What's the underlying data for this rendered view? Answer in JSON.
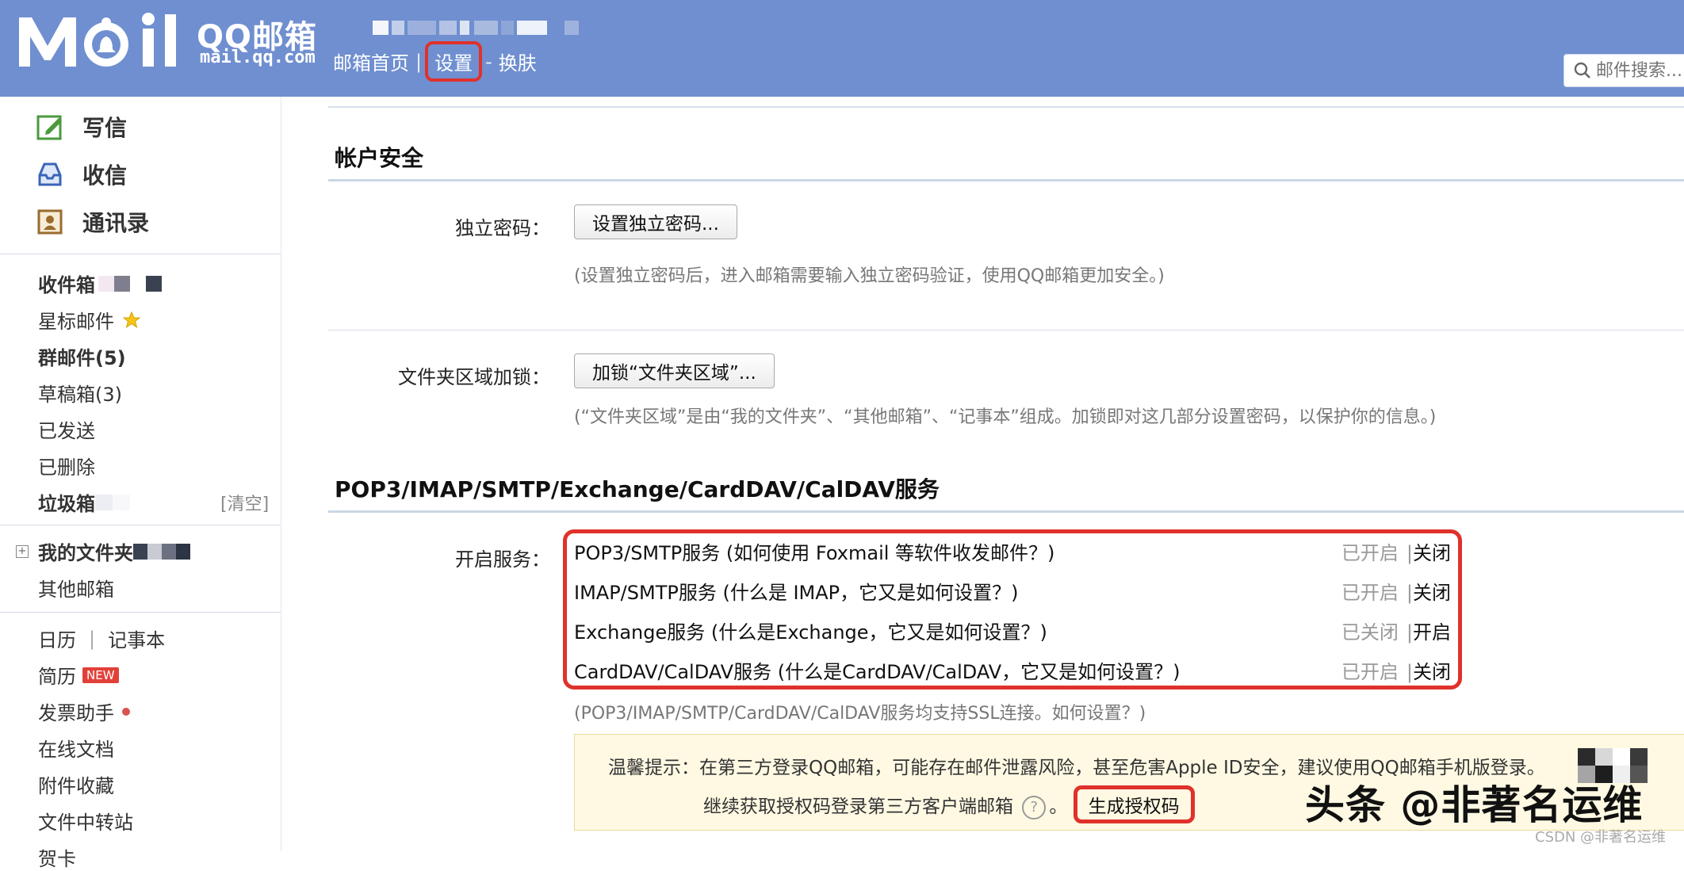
{
  "header": {
    "brand_title": "QQ邮箱",
    "brand_url": "mail.qq.com",
    "nav": {
      "home": "邮箱首页",
      "separator1": "|",
      "settings": "设置",
      "separator2": "-",
      "skin": "换肤"
    },
    "search_placeholder": "邮件搜索..."
  },
  "sidebar": {
    "actions": {
      "compose": "写信",
      "inbox": "收信",
      "contacts": "通讯录"
    },
    "folders": {
      "inbox": "收件箱",
      "starred": "星标邮件",
      "group": "群邮件(5)",
      "drafts": "草稿箱(3)",
      "sent": "已发送",
      "deleted": "已删除",
      "spam": "垃圾箱",
      "clear": "[清空]",
      "my_folders": "我的文件夹",
      "other_mailbox": "其他邮箱"
    },
    "apps": {
      "calendar": "日历",
      "pipe": "|",
      "notebook": "记事本",
      "resume": "简历",
      "new_badge": "NEW",
      "invoice": "发票助手",
      "docs": "在线文档",
      "attachments": "附件收藏",
      "transfer": "文件中转站",
      "cards": "贺卡"
    }
  },
  "content": {
    "account_security": {
      "title": "帐户安全",
      "independent_password_label": "独立密码：",
      "independent_password_button": "设置独立密码...",
      "independent_password_hint": "(设置独立密码后，进入邮箱需要输入独立密码验证，使用QQ邮箱更加安全。)",
      "folder_lock_label": "文件夹区域加锁：",
      "folder_lock_button": "加锁“文件夹区域”...",
      "folder_lock_hint": "(“文件夹区域”是由“我的文件夹”、“其他邮箱”、“记事本”组成。加锁即对这几部分设置密码，以保护你的信息。)"
    },
    "services": {
      "title": "POP3/IMAP/SMTP/Exchange/CardDAV/CalDAV服务",
      "label": "开启服务：",
      "rows": [
        {
          "name": "POP3/SMTP服务 (如何使用 Foxmail 等软件收发邮件？)",
          "status": "已开启",
          "bar": "|",
          "action": "关闭"
        },
        {
          "name": "IMAP/SMTP服务 (什么是 IMAP，它又是如何设置？)",
          "status": "已开启",
          "bar": "|",
          "action": "关闭"
        },
        {
          "name": "Exchange服务 (什么是Exchange，它又是如何设置？)",
          "status": "已关闭",
          "bar": "|",
          "action": "开启"
        },
        {
          "name": "CardDAV/CalDAV服务 (什么是CardDAV/CalDAV，它又是如何设置？)",
          "status": "已开启",
          "bar": "|",
          "action": "关闭"
        }
      ],
      "ssl_hint": "(POP3/IMAP/SMTP/CardDAV/CalDAV服务均支持SSL连接。如何设置？)"
    },
    "tip": {
      "line1": "温馨提示：在第三方登录QQ邮箱，可能存在邮件泄露风险，甚至危害Apple ID安全，建议使用QQ邮箱手机版登录。",
      "line2_prefix": "继续获取授权码登录第三方客户端邮箱",
      "help": "?",
      "period": "。",
      "generate_button": "生成授权码"
    }
  },
  "watermark": {
    "text": "头条 @非著名运维",
    "csdn": "CSDN @非著名运维"
  },
  "colors": {
    "header_bg": "#6f8fd0",
    "highlight": "#e0312b",
    "tip_bg": "#fff9e3"
  }
}
